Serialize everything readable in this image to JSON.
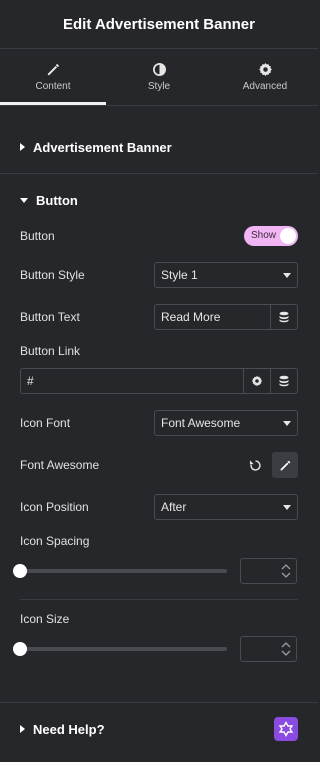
{
  "header": {
    "title": "Edit Advertisement Banner"
  },
  "tabs": [
    {
      "label": "Content"
    },
    {
      "label": "Style"
    },
    {
      "label": "Advanced"
    }
  ],
  "sections": {
    "advertisement": "Advertisement Banner",
    "button": "Button",
    "help": "Need Help?"
  },
  "fields": {
    "button": {
      "label": "Button",
      "toggle": "Show"
    },
    "button_style": {
      "label": "Button Style",
      "value": "Style 1"
    },
    "button_text": {
      "label": "Button Text",
      "value": "Read More"
    },
    "button_link": {
      "label": "Button Link",
      "value": "#"
    },
    "icon_font": {
      "label": "Icon Font",
      "value": "Font Awesome"
    },
    "font_awesome": {
      "label": "Font Awesome"
    },
    "icon_position": {
      "label": "Icon Position",
      "value": "After"
    },
    "icon_spacing": {
      "label": "Icon Spacing"
    },
    "icon_size": {
      "label": "Icon Size"
    }
  },
  "colors": {
    "background": "#26272b",
    "toggle": "#f2b5f4",
    "help_icon": "#8a4be0"
  }
}
